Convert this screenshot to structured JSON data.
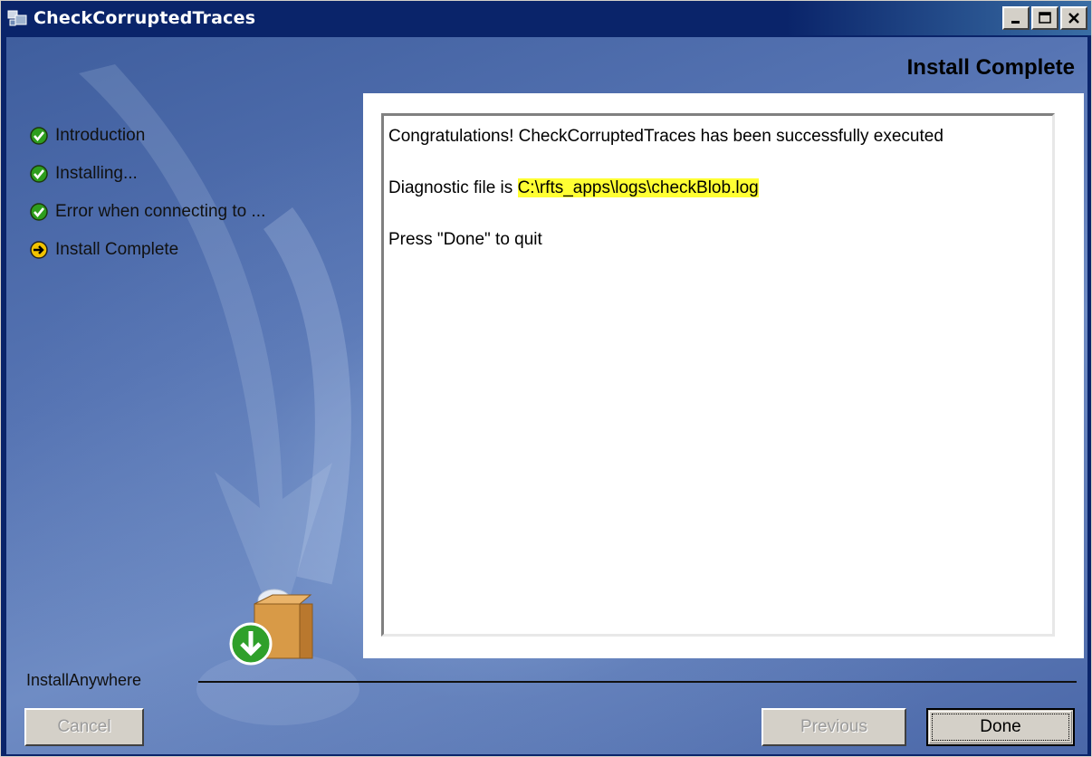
{
  "window": {
    "title": "CheckCorruptedTraces"
  },
  "header": {
    "page_title": "Install Complete"
  },
  "steps": [
    {
      "label": "Introduction",
      "state": "done",
      "icon": "check-circle-icon"
    },
    {
      "label": "Installing...",
      "state": "done",
      "icon": "check-circle-icon"
    },
    {
      "label": "Error when connecting to ...",
      "state": "done",
      "icon": "check-circle-icon"
    },
    {
      "label": "Install Complete",
      "state": "current",
      "icon": "arrow-right-circle-icon"
    }
  ],
  "message": {
    "line1": "Congratulations! CheckCorruptedTraces has been successfully executed",
    "diag_prefix": "Diagnostic file is ",
    "diag_path": "C:\\rfts_apps\\logs\\checkBlob.log",
    "line3": "Press \"Done\" to quit"
  },
  "footer": {
    "brand": "InstallAnywhere",
    "cancel_label": "Cancel",
    "previous_label": "Previous",
    "done_label": "Done"
  },
  "colors": {
    "title_bar": "#0a246a",
    "highlight": "#ffff33",
    "check": "#2e9e1e",
    "current_arrow": "#f2c300"
  }
}
